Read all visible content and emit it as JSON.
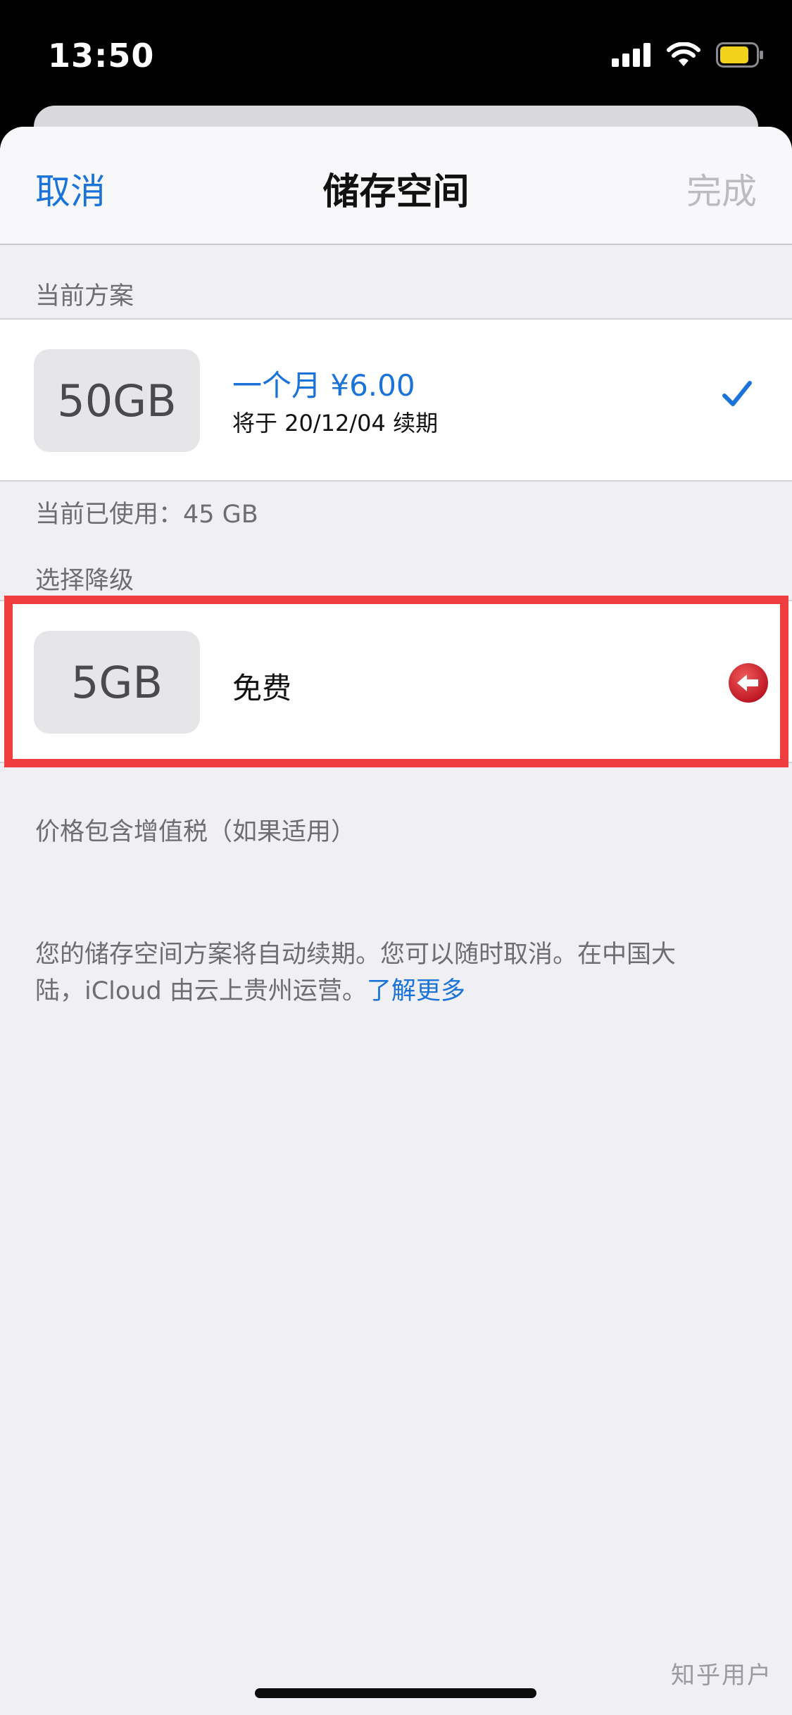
{
  "status_bar": {
    "time": "13:50"
  },
  "nav": {
    "cancel": "取消",
    "title": "储存空间",
    "done": "完成"
  },
  "current_plan": {
    "section_label": "当前方案",
    "size": "50GB",
    "price": "一个月 ¥6.00",
    "renewal": "将于 20/12/04 续期",
    "usage": "当前已使用：45 GB"
  },
  "downgrade": {
    "section_label": "选择降级",
    "size": "5GB",
    "label": "免费"
  },
  "footer": {
    "tax_note": "价格包含增值税（如果适用）",
    "auto_renew_line1": "您的储存空间方案将自动续期。您可以随时取消。在中国大",
    "auto_renew_line2": "陆，iCloud 由云上贵州运营。",
    "learn_more": "了解更多"
  },
  "watermark": "知乎用户",
  "colors": {
    "accent": "#1a73d8",
    "highlight": "#ef3c3c",
    "downgrade_icon": "#d0202e"
  }
}
